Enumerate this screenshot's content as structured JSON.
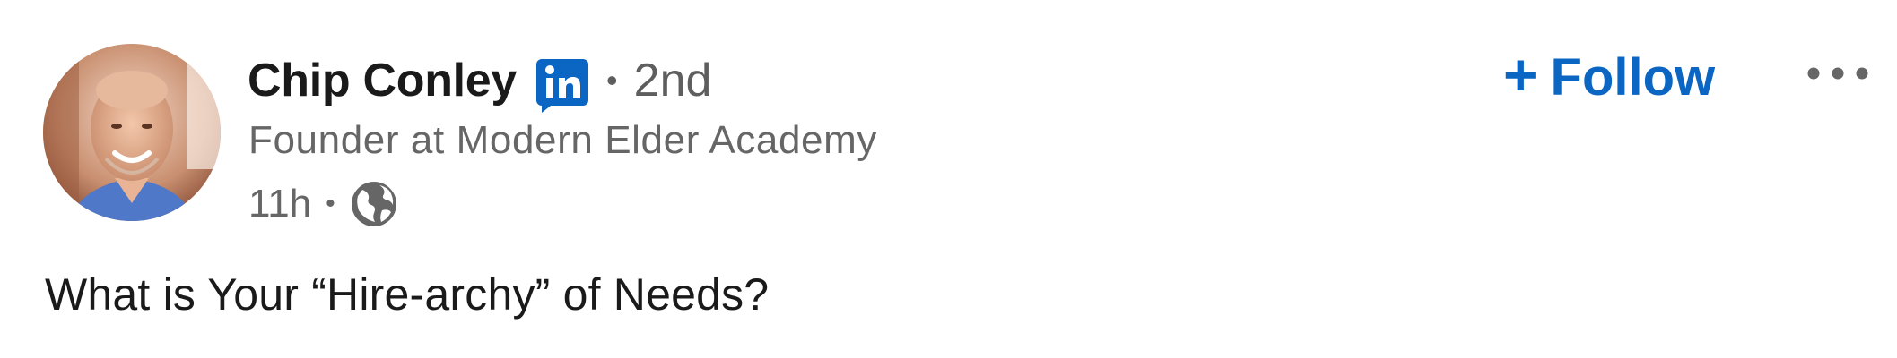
{
  "post": {
    "actor": {
      "name": "Chip Conley",
      "degree": "2nd",
      "separator": "•",
      "headline": "Founder at Modern Elder Academy",
      "avatar_icon": "profile-photo",
      "badge_icon": "linkedin-premium-icon"
    },
    "meta": {
      "time": "11h",
      "separator": "•",
      "visibility_icon": "globe-icon"
    },
    "follow": {
      "plus": "+",
      "label": "Follow"
    },
    "more_icon": "ellipsis-icon",
    "text": "What is Your “Hire-archy” of Needs?"
  },
  "colors": {
    "accent": "#0a66c2",
    "name_text": "#1a1a1a",
    "secondary_text": "#666666"
  }
}
